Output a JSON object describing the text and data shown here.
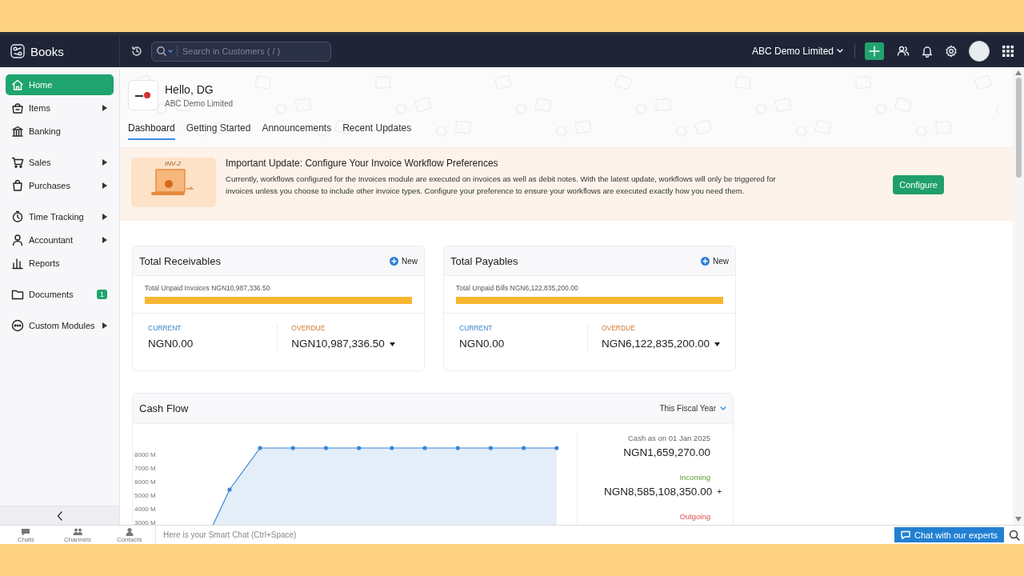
{
  "top_bar": {
    "app_name": "Books",
    "search": {
      "placeholder": "Search in Customers ( / )"
    },
    "org_name": "ABC Demo Limited"
  },
  "sidebar": {
    "items": [
      {
        "label": "Home",
        "selected": true,
        "has_submenu": false
      },
      {
        "label": "Items",
        "selected": false,
        "has_submenu": true
      },
      {
        "label": "Banking",
        "selected": false,
        "has_submenu": false
      },
      {
        "label": "Sales",
        "selected": false,
        "has_submenu": true
      },
      {
        "label": "Purchases",
        "selected": false,
        "has_submenu": true
      },
      {
        "label": "Time Tracking",
        "selected": false,
        "has_submenu": true
      },
      {
        "label": "Accountant",
        "selected": false,
        "has_submenu": true
      },
      {
        "label": "Reports",
        "selected": false,
        "has_submenu": false
      },
      {
        "label": "Documents",
        "selected": false,
        "has_submenu": false,
        "badge": "1"
      },
      {
        "label": "Custom Modules",
        "selected": false,
        "has_submenu": true
      }
    ]
  },
  "greeting": {
    "title": "Hello, DG",
    "subtitle": "ABC Demo Limited"
  },
  "tabs": [
    {
      "label": "Dashboard",
      "selected": true
    },
    {
      "label": "Getting Started",
      "selected": false
    },
    {
      "label": "Announcements",
      "selected": false
    },
    {
      "label": "Recent Updates",
      "selected": false
    }
  ],
  "banner": {
    "illustration_label": "INV-2",
    "title": "Important Update: Configure Your Invoice Workflow Preferences",
    "text": "Currently, workflows configured for the Invoices module are executed on invoices as well as debit notes. With the latest update, workflows will only be triggered for invoices unless you choose to include other invoice types. Configure your preference to ensure your workflows are executed exactly how you need them.",
    "button": "Configure"
  },
  "summary_cards": [
    {
      "title": "Total Receivables",
      "new_label": "New",
      "unpaid_label": "Total Unpaid Invoices NGN10,987,336.50",
      "level": 1,
      "current_label": "CURRENT",
      "current_value": "NGN0.00",
      "overdue_label": "OVERDUE",
      "overdue_value": "NGN10,987,336.50"
    },
    {
      "title": "Total Payables",
      "new_label": "New",
      "unpaid_label": "Total Unpaid Bills NGN6,122,835,200.00",
      "level": 1,
      "current_label": "CURRENT",
      "current_value": "NGN0.00",
      "overdue_label": "OVERDUE",
      "overdue_value": "NGN6,122,835,200.00"
    }
  ],
  "cash_flow": {
    "title": "Cash Flow",
    "period": "This Fiscal Year",
    "axis_labels": [
      "8000 M",
      "7000 M",
      "6000 M",
      "5000 M",
      "4000 M",
      "3000 M"
    ],
    "figures": [
      {
        "kind": "balance",
        "label": "Cash as on 01 Jan 2025",
        "value": "NGN1,659,270.00"
      },
      {
        "kind": "incoming",
        "label": "Incoming",
        "value": "NGN8,585,108,350.00",
        "sign": "+"
      },
      {
        "kind": "outgoing",
        "label": "Outgoing"
      }
    ]
  },
  "chat_bar": {
    "tabs": [
      "Chats",
      "Channels",
      "Contacts"
    ],
    "placeholder": "Here is your Smart Chat (Ctrl+Space)",
    "button": "Chat with our experts"
  }
}
